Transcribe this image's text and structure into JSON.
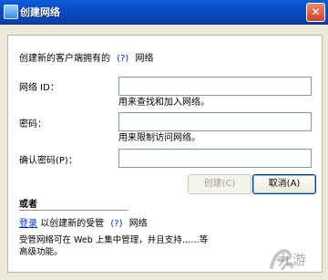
{
  "window": {
    "title": "创建网络"
  },
  "header": {
    "prefix": "创建新的客户端拥有的",
    "help": "(?)",
    "suffix": "网络"
  },
  "form": {
    "network_id_label": "网络 ID：",
    "network_id_value": "",
    "network_id_hint": "用来查找和加入网络。",
    "password_label": "密码：",
    "password_value": "",
    "password_hint": "用来限制访问网络。",
    "confirm_label": "确认密码(P)：",
    "confirm_value": ""
  },
  "buttons": {
    "create": "创建(C)",
    "cancel": "取消(A)"
  },
  "or_section": {
    "title": "或者",
    "login_link": "登录",
    "text": "以创建新的受管",
    "help": "(?)",
    "suffix": "网络",
    "description": "受管网络可在 Web 上集中管理，并且支持……等高级功能。"
  },
  "watermark": {
    "text": "九游"
  }
}
